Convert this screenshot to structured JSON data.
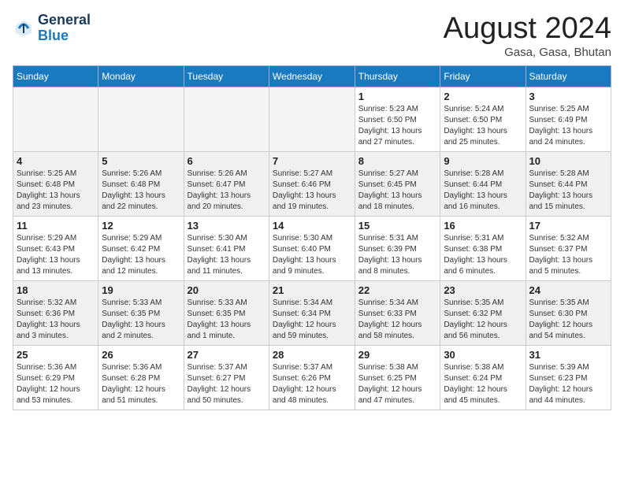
{
  "logo": {
    "text1": "General",
    "text2": "Blue"
  },
  "title": "August 2024",
  "location": "Gasa, Gasa, Bhutan",
  "weekdays": [
    "Sunday",
    "Monday",
    "Tuesday",
    "Wednesday",
    "Thursday",
    "Friday",
    "Saturday"
  ],
  "rows": [
    [
      {
        "day": "",
        "info": ""
      },
      {
        "day": "",
        "info": ""
      },
      {
        "day": "",
        "info": ""
      },
      {
        "day": "",
        "info": ""
      },
      {
        "day": "1",
        "info": "Sunrise: 5:23 AM\nSunset: 6:50 PM\nDaylight: 13 hours and 27 minutes."
      },
      {
        "day": "2",
        "info": "Sunrise: 5:24 AM\nSunset: 6:50 PM\nDaylight: 13 hours and 25 minutes."
      },
      {
        "day": "3",
        "info": "Sunrise: 5:25 AM\nSunset: 6:49 PM\nDaylight: 13 hours and 24 minutes."
      }
    ],
    [
      {
        "day": "4",
        "info": "Sunrise: 5:25 AM\nSunset: 6:48 PM\nDaylight: 13 hours and 23 minutes."
      },
      {
        "day": "5",
        "info": "Sunrise: 5:26 AM\nSunset: 6:48 PM\nDaylight: 13 hours and 22 minutes."
      },
      {
        "day": "6",
        "info": "Sunrise: 5:26 AM\nSunset: 6:47 PM\nDaylight: 13 hours and 20 minutes."
      },
      {
        "day": "7",
        "info": "Sunrise: 5:27 AM\nSunset: 6:46 PM\nDaylight: 13 hours and 19 minutes."
      },
      {
        "day": "8",
        "info": "Sunrise: 5:27 AM\nSunset: 6:45 PM\nDaylight: 13 hours and 18 minutes."
      },
      {
        "day": "9",
        "info": "Sunrise: 5:28 AM\nSunset: 6:44 PM\nDaylight: 13 hours and 16 minutes."
      },
      {
        "day": "10",
        "info": "Sunrise: 5:28 AM\nSunset: 6:44 PM\nDaylight: 13 hours and 15 minutes."
      }
    ],
    [
      {
        "day": "11",
        "info": "Sunrise: 5:29 AM\nSunset: 6:43 PM\nDaylight: 13 hours and 13 minutes."
      },
      {
        "day": "12",
        "info": "Sunrise: 5:29 AM\nSunset: 6:42 PM\nDaylight: 13 hours and 12 minutes."
      },
      {
        "day": "13",
        "info": "Sunrise: 5:30 AM\nSunset: 6:41 PM\nDaylight: 13 hours and 11 minutes."
      },
      {
        "day": "14",
        "info": "Sunrise: 5:30 AM\nSunset: 6:40 PM\nDaylight: 13 hours and 9 minutes."
      },
      {
        "day": "15",
        "info": "Sunrise: 5:31 AM\nSunset: 6:39 PM\nDaylight: 13 hours and 8 minutes."
      },
      {
        "day": "16",
        "info": "Sunrise: 5:31 AM\nSunset: 6:38 PM\nDaylight: 13 hours and 6 minutes."
      },
      {
        "day": "17",
        "info": "Sunrise: 5:32 AM\nSunset: 6:37 PM\nDaylight: 13 hours and 5 minutes."
      }
    ],
    [
      {
        "day": "18",
        "info": "Sunrise: 5:32 AM\nSunset: 6:36 PM\nDaylight: 13 hours and 3 minutes."
      },
      {
        "day": "19",
        "info": "Sunrise: 5:33 AM\nSunset: 6:35 PM\nDaylight: 13 hours and 2 minutes."
      },
      {
        "day": "20",
        "info": "Sunrise: 5:33 AM\nSunset: 6:35 PM\nDaylight: 13 hours and 1 minute."
      },
      {
        "day": "21",
        "info": "Sunrise: 5:34 AM\nSunset: 6:34 PM\nDaylight: 12 hours and 59 minutes."
      },
      {
        "day": "22",
        "info": "Sunrise: 5:34 AM\nSunset: 6:33 PM\nDaylight: 12 hours and 58 minutes."
      },
      {
        "day": "23",
        "info": "Sunrise: 5:35 AM\nSunset: 6:32 PM\nDaylight: 12 hours and 56 minutes."
      },
      {
        "day": "24",
        "info": "Sunrise: 5:35 AM\nSunset: 6:30 PM\nDaylight: 12 hours and 54 minutes."
      }
    ],
    [
      {
        "day": "25",
        "info": "Sunrise: 5:36 AM\nSunset: 6:29 PM\nDaylight: 12 hours and 53 minutes."
      },
      {
        "day": "26",
        "info": "Sunrise: 5:36 AM\nSunset: 6:28 PM\nDaylight: 12 hours and 51 minutes."
      },
      {
        "day": "27",
        "info": "Sunrise: 5:37 AM\nSunset: 6:27 PM\nDaylight: 12 hours and 50 minutes."
      },
      {
        "day": "28",
        "info": "Sunrise: 5:37 AM\nSunset: 6:26 PM\nDaylight: 12 hours and 48 minutes."
      },
      {
        "day": "29",
        "info": "Sunrise: 5:38 AM\nSunset: 6:25 PM\nDaylight: 12 hours and 47 minutes."
      },
      {
        "day": "30",
        "info": "Sunrise: 5:38 AM\nSunset: 6:24 PM\nDaylight: 12 hours and 45 minutes."
      },
      {
        "day": "31",
        "info": "Sunrise: 5:39 AM\nSunset: 6:23 PM\nDaylight: 12 hours and 44 minutes."
      }
    ]
  ]
}
